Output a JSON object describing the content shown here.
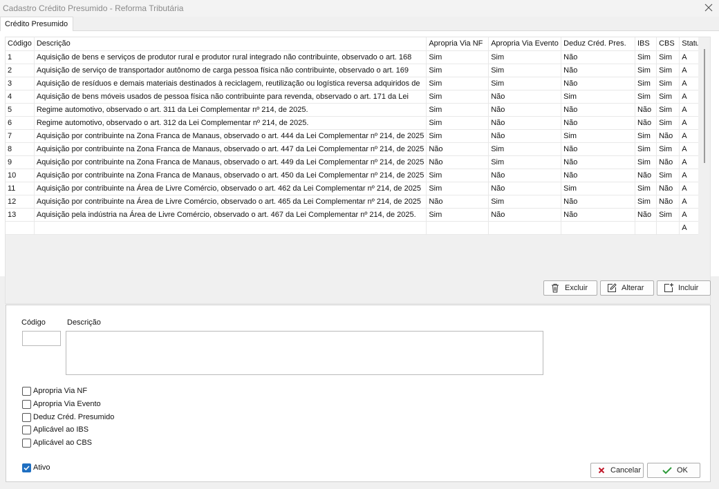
{
  "window": {
    "title": "Cadastro Crédito Presumido - Reforma Tributária"
  },
  "tabs": [
    {
      "label": "Crédito Presumido"
    }
  ],
  "grid": {
    "columns": [
      "Código",
      "Descrição",
      "Apropria Via NF",
      "Apropria Via Evento",
      "Deduz Créd. Pres.",
      "IBS",
      "CBS",
      "Status"
    ],
    "rows": [
      [
        "1",
        "Aquisição de bens e serviços de produtor rural e produtor rural integrado não contribuinte, observado o art. 168",
        "Sim",
        "Sim",
        "Não",
        "Sim",
        "Sim",
        "A"
      ],
      [
        "2",
        "Aquisição de serviço de transportador autônomo de carga pessoa física não contribuinte, observado o art. 169",
        "Sim",
        "Sim",
        "Não",
        "Sim",
        "Sim",
        "A"
      ],
      [
        "3",
        "Aquisição de resíduos e demais materiais destinados à reciclagem, reutilização ou logística reversa adquiridos de",
        "Sim",
        "Sim",
        "Não",
        "Sim",
        "Sim",
        "A"
      ],
      [
        "4",
        "Aquisição de bens móveis usados de pessoa física não contribuinte para revenda, observado o art. 171 da Lei",
        "Sim",
        "Não",
        "Sim",
        "Sim",
        "Sim",
        "A"
      ],
      [
        "5",
        "Regime automotivo, observado o art. 311 da Lei Complementar nº 214, de 2025.",
        "Sim",
        "Não",
        "Não",
        "Não",
        "Sim",
        "A"
      ],
      [
        "6",
        "Regime automotivo, observado o art. 312 da Lei Complementar nº 214, de 2025.",
        "Sim",
        "Não",
        "Não",
        "Não",
        "Sim",
        "A"
      ],
      [
        "7",
        "Aquisição por contribuinte na Zona Franca de Manaus, observado o art. 444 da Lei Complementar nº 214, de 2025",
        "Sim",
        "Não",
        "Sim",
        "Sim",
        "Não",
        "A"
      ],
      [
        "8",
        "Aquisição por contribuinte na Zona Franca de Manaus, observado o art. 447 da Lei Complementar nº 214, de 2025",
        "Não",
        "Sim",
        "Não",
        "Sim",
        "Sim",
        "A"
      ],
      [
        "9",
        "Aquisição por contribuinte na Zona Franca de Manaus, observado o art. 449 da Lei Complementar nº 214, de 2025",
        "Não",
        "Sim",
        "Não",
        "Sim",
        "Não",
        "A"
      ],
      [
        "10",
        "Aquisição por contribuinte na Zona Franca de Manaus, observado o art. 450 da Lei Complementar nº 214, de 2025",
        "Sim",
        "Não",
        "Não",
        "Não",
        "Sim",
        "A"
      ],
      [
        "11",
        "Aquisição por contribuinte na Área de Livre Comércio, observado o art. 462 da Lei Complementar nº 214, de 2025",
        "Sim",
        "Não",
        "Sim",
        "Sim",
        "Não",
        "A"
      ],
      [
        "12",
        "Aquisição por contribuinte na Área de Livre Comércio, observado o art. 465 da Lei Complementar nº 214, de 2025",
        "Não",
        "Sim",
        "Não",
        "Sim",
        "Não",
        "A"
      ],
      [
        "13",
        "Aquisição pela indústria na Área de Livre Comércio, observado o art. 467 da Lei Complementar nº 214, de 2025.",
        "Sim",
        "Não",
        "Não",
        "Não",
        "Sim",
        "A"
      ],
      [
        "",
        "",
        "",
        "",
        "",
        "",
        "",
        "A"
      ]
    ]
  },
  "actions": {
    "excluir": "Excluir",
    "alterar": "Alterar",
    "incluir": "Incluir"
  },
  "form": {
    "codigo_label": "Código",
    "descricao_label": "Descrição",
    "codigo_value": "",
    "descricao_value": "",
    "checkboxes": [
      {
        "label": "Apropria Via NF",
        "checked": false
      },
      {
        "label": "Apropria Via Evento",
        "checked": false
      },
      {
        "label": "Deduz Créd. Presumido",
        "checked": false
      },
      {
        "label": "Aplicável ao IBS",
        "checked": false
      },
      {
        "label": "Aplicável ao CBS",
        "checked": false
      }
    ],
    "ativo": {
      "label": "Ativo",
      "checked": true
    },
    "cancel_label": "Cancelar",
    "ok_label": "OK"
  },
  "colors": {
    "check_blue": "#1f6fc1",
    "cancel_red": "#c0182a",
    "ok_green": "#2e9b3a"
  },
  "icons": [
    "close-icon",
    "trash-icon",
    "edit-icon",
    "add-icon",
    "cancel-x-icon",
    "ok-check-icon",
    "checkmark-icon"
  ]
}
